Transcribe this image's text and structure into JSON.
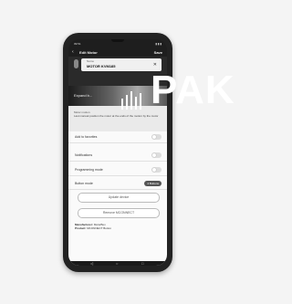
{
  "status": {
    "time": "09:51",
    "icons": "▮ ▮ ▮"
  },
  "appbar": {
    "back": "‹",
    "title": "Edit Motor",
    "save": "Save"
  },
  "name": {
    "label": "Name",
    "value": "MOTOR KVM185",
    "clear": "✕"
  },
  "banner": {
    "text": "Expand b..."
  },
  "watermark": {
    "text": "PAK"
  },
  "motion": {
    "title": "Motor motion",
    "desc": "Last manual position the motor at the ends of the motion by the motor"
  },
  "rows": {
    "favourites": "Add to favorites",
    "notifications": "Notifications",
    "programming": "Programming mode",
    "button_mode": "Button mode",
    "button_mode_value": "4 Buttons"
  },
  "buttons": {
    "update": "Update device",
    "remove": "Remove MCONNECT"
  },
  "manufacturer": {
    "label": "Manufacturer:",
    "value": "MotorBox",
    "product_label": "Product:",
    "product_value": "MCONNECT Button"
  },
  "navbar": {
    "back": "◁",
    "home": "○",
    "recent": "□"
  }
}
